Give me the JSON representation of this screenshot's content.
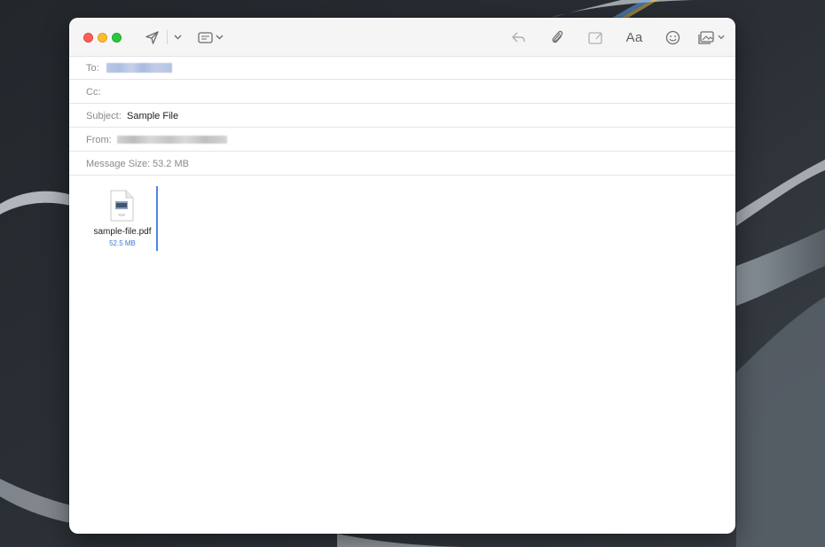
{
  "window": {
    "traffic_lights": [
      "close",
      "minimize",
      "zoom"
    ]
  },
  "toolbar": {
    "icons": [
      "send-icon",
      "chevron-down-icon",
      "header-fields-icon",
      "chevron-down-icon",
      "reply-icon",
      "attachment-icon",
      "markup-icon",
      "format-icon",
      "emoji-icon",
      "photo-browser-icon",
      "chevron-down-icon"
    ],
    "format_label": "Aa"
  },
  "header": {
    "to_label": "To:",
    "cc_label": "Cc:",
    "subject_label": "Subject:",
    "subject_value": "Sample File",
    "from_label": "From:",
    "size_label": "Message Size:",
    "size_value": "53.2 MB"
  },
  "attachment": {
    "icon": "pdf-file-icon",
    "icon_text": "PDF",
    "filename": "sample-file.pdf",
    "filesize": "52.5 MB"
  },
  "colors": {
    "accent": "#3a78d3",
    "close": "#fe5f57",
    "minimize": "#febc2e",
    "zoom": "#28c840"
  }
}
